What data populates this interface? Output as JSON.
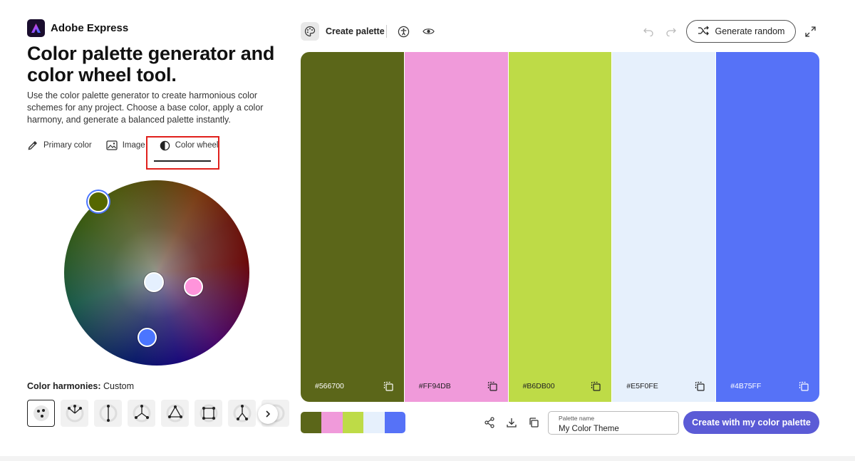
{
  "brand": {
    "name": "Adobe Express"
  },
  "headline": "Color palette generator and color wheel tool.",
  "intro": "Use the color palette generator to create harmonious color schemes for any project. Choose a base color, apply a color harmony, and generate a balanced palette instantly.",
  "mode_tabs": [
    {
      "label": "Primary color",
      "icon": "eyedropper-icon",
      "active": false
    },
    {
      "label": "Image",
      "icon": "image-icon",
      "active": false
    },
    {
      "label": "Color wheel",
      "icon": "color-wheel-icon",
      "active": true
    }
  ],
  "harmonies": {
    "label": "Color harmonies:",
    "value": "Custom",
    "options": [
      "custom",
      "analogous",
      "complementary",
      "split-complementary",
      "triad",
      "square",
      "compound",
      "shades"
    ]
  },
  "toolbar": {
    "create_label": "Create palette",
    "generate_label": "Generate random"
  },
  "palette": {
    "colors": [
      "#566700",
      "#FF94DB",
      "#B6DB00",
      "#E5F0FE",
      "#4B75FF"
    ],
    "swatch_bg": [
      "#5B6619",
      "#F09ADA",
      "#BEDB47",
      "#E6F0FC",
      "#5672F7"
    ],
    "hex_labels": [
      "#566700",
      "#FF94DB",
      "#B6DB00",
      "#E5F0FE",
      "#4B75FF"
    ],
    "label_text_colors": [
      "#ffffff",
      "#222222",
      "#222222",
      "#222222",
      "#ffffff"
    ]
  },
  "palette_name": {
    "label": "Palette name",
    "value": "My Color Theme"
  },
  "cta_label": "Create with my color palette",
  "accent_color": "#5B5BD6",
  "highlight_color": "#E0201C"
}
